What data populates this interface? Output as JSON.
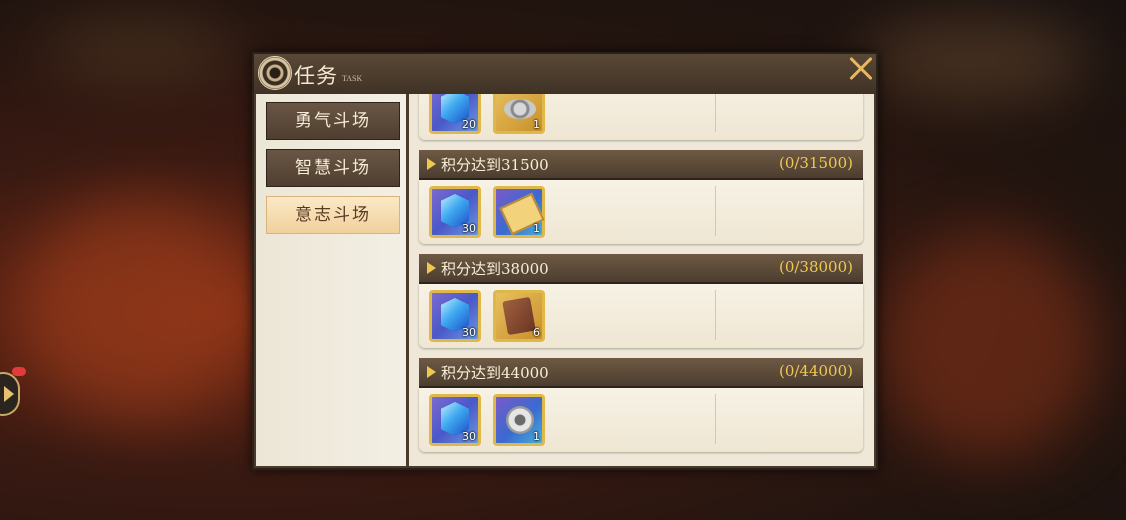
{
  "window": {
    "title": "任务",
    "subtitle": "TASK"
  },
  "tabs": [
    {
      "label": "勇气斗场",
      "active": false
    },
    {
      "label": "智慧斗场",
      "active": false
    },
    {
      "label": "意志斗场",
      "active": true
    }
  ],
  "tasks": [
    {
      "name": "",
      "progress": "",
      "rewards": [
        {
          "icon": "blue-crystal-icon",
          "count": "20"
        },
        {
          "icon": "silver-coins-icon",
          "count": "1"
        }
      ]
    },
    {
      "name": "积分达到31500",
      "progress": "(0/31500)",
      "rewards": [
        {
          "icon": "blue-crystal-icon",
          "count": "30"
        },
        {
          "icon": "golden-ticket-icon",
          "count": "1"
        }
      ]
    },
    {
      "name": "积分达到38000",
      "progress": "(0/38000)",
      "rewards": [
        {
          "icon": "blue-crystal-icon",
          "count": "30"
        },
        {
          "icon": "leather-book-icon",
          "count": "6"
        }
      ]
    },
    {
      "name": "积分达到44000",
      "progress": "(0/44000)",
      "rewards": [
        {
          "icon": "blue-crystal-icon",
          "count": "30"
        },
        {
          "icon": "silver-gear-icon",
          "count": "1"
        }
      ]
    }
  ],
  "colors": {
    "accent": "#f0c850",
    "panel": "#4a3b2d",
    "active_tab": "#f1d09c"
  }
}
